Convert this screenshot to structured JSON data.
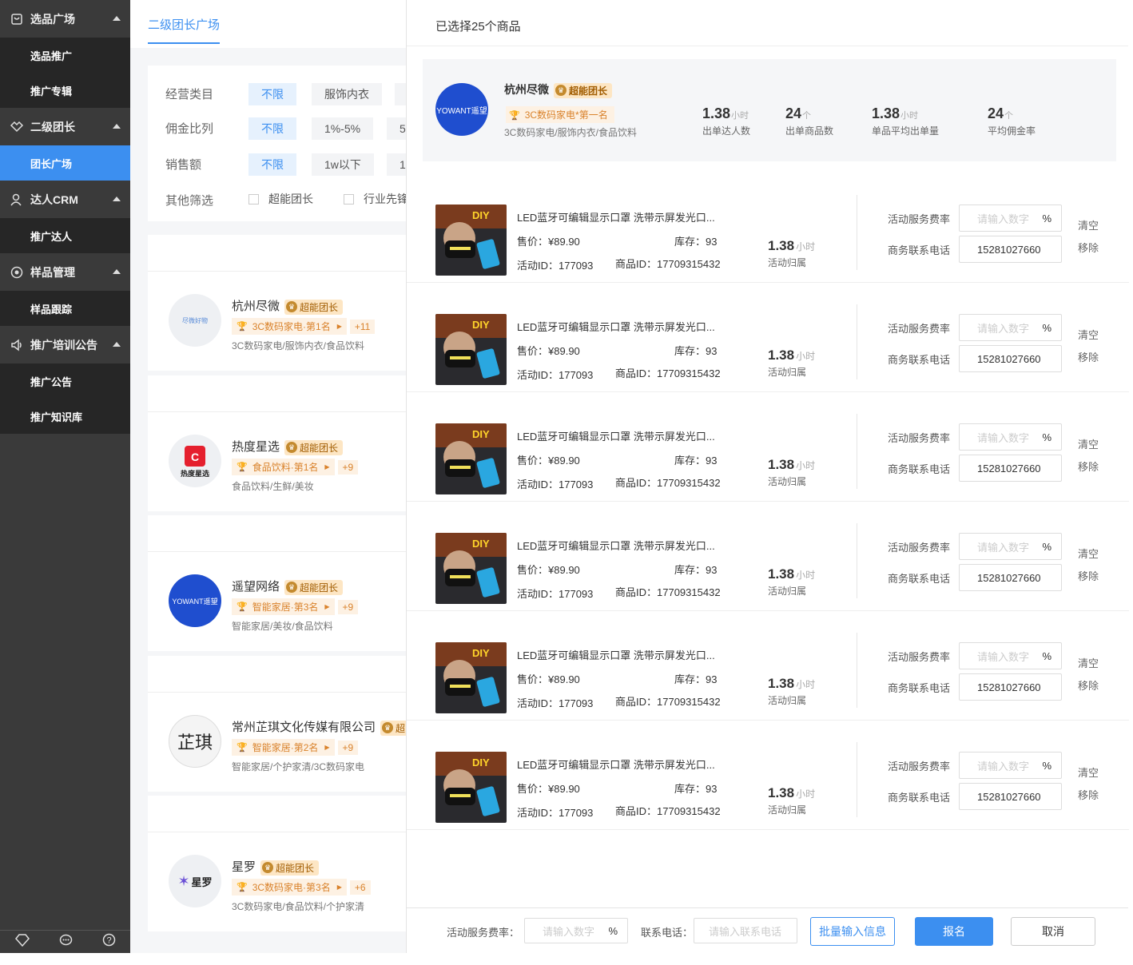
{
  "sidebar": {
    "groups": [
      {
        "label": "选品广场",
        "icon": "bag-icon",
        "subs": [
          "选品推广",
          "推广专辑"
        ]
      },
      {
        "label": "二级团长",
        "icon": "handshake-icon",
        "subs": [
          "团长广场"
        ]
      },
      {
        "label": "达人CRM",
        "icon": "user-icon",
        "subs": [
          "推广达人"
        ]
      },
      {
        "label": "样品管理",
        "icon": "eye-icon",
        "subs": [
          "样品跟踪"
        ]
      },
      {
        "label": "推广培训公告",
        "icon": "speaker-icon",
        "subs": [
          "推广公告",
          "推广知识库"
        ]
      }
    ],
    "active_sub": "团长广场",
    "bottom_icons": [
      "diamond-icon",
      "chat-icon",
      "help-icon"
    ]
  },
  "mid": {
    "tab": "二级团长广场",
    "filters": {
      "rows": [
        {
          "label": "经营类目",
          "options": [
            "不限",
            "服饰内衣"
          ]
        },
        {
          "label": "佣金比列",
          "options": [
            "不限",
            "1%-5%",
            "5"
          ]
        },
        {
          "label": "销售额",
          "options": [
            "不限",
            "1w以下",
            "1"
          ]
        }
      ],
      "other_label": "其他筛选",
      "checks": [
        "超能团长",
        "行业先锋"
      ]
    },
    "teams": [
      {
        "name": "杭州尽微",
        "badge": "超能团长",
        "rank": "3C数码家电·第1名",
        "more": "+11",
        "cats": "3C数码家电/服饰内衣/食品饮料",
        "logo_text": "尽微好物"
      },
      {
        "name": "热度星选",
        "badge": "超能团长",
        "rank": "食品饮料·第1名",
        "more": "+9",
        "cats": "食品饮料/生鲜/美妆",
        "logo_text": "热度星选"
      },
      {
        "name": "遥望网络",
        "badge": "超能团长",
        "rank": "智能家居·第3名",
        "more": "+9",
        "cats": "智能家居/美妆/食品饮料",
        "logo_text": "YOWANT遥望"
      },
      {
        "name": "常州芷琪文化传媒有限公司",
        "badge": "超",
        "rank": "智能家居·第2名",
        "more": "+9",
        "cats": "智能家居/个护家清/3C数码家电",
        "logo_text": "芷琪"
      },
      {
        "name": "星罗",
        "badge": "超能团长",
        "rank": "3C数码家电·第3名",
        "more": "+6",
        "cats": "3C数码家电/食品饮料/个护家清",
        "logo_text": "星罗"
      }
    ]
  },
  "panel": {
    "title": "已选择25个商品",
    "team": {
      "name": "杭州尽微",
      "badge": "超能团长",
      "rank": "3C数码家电*第一名",
      "cats": "3C数码家电/服饰内衣/食品饮料",
      "logo_text": "YOWANT遥望",
      "stats": [
        {
          "value": "1.38",
          "unit": "小时",
          "label": "出单达人数"
        },
        {
          "value": "24",
          "unit": "个",
          "label": "出单商品数"
        },
        {
          "value": "1.38",
          "unit": "小时",
          "label": "单品平均出单量"
        },
        {
          "value": "24",
          "unit": "个",
          "label": "平均佣金率"
        }
      ]
    },
    "product_labels": {
      "price_prefix": "售价：",
      "stock_prefix": "库存：",
      "aid_prefix": "活动ID：",
      "gid_prefix": "商品ID：",
      "hrs_unit": "小时",
      "hrs_label": "活动归属",
      "fee_label": "活动服务费率",
      "fee_placeholder": "请输入数字",
      "pct": "%",
      "phone_label": "商务联系电话",
      "clear": "清空",
      "remove": "移除"
    },
    "products": [
      {
        "title": "LED蓝牙可编辑显示口罩 洗带示屏发光口...",
        "price": "¥89.90",
        "stock": "93",
        "activity_id": "177093",
        "goods_id": "17709315432",
        "hours": "1.38",
        "phone": "15281027660"
      },
      {
        "title": "LED蓝牙可编辑显示口罩 洗带示屏发光口...",
        "price": "¥89.90",
        "stock": "93",
        "activity_id": "177093",
        "goods_id": "17709315432",
        "hours": "1.38",
        "phone": "15281027660"
      },
      {
        "title": "LED蓝牙可编辑显示口罩 洗带示屏发光口...",
        "price": "¥89.90",
        "stock": "93",
        "activity_id": "177093",
        "goods_id": "17709315432",
        "hours": "1.38",
        "phone": "15281027660"
      },
      {
        "title": "LED蓝牙可编辑显示口罩 洗带示屏发光口...",
        "price": "¥89.90",
        "stock": "93",
        "activity_id": "177093",
        "goods_id": "17709315432",
        "hours": "1.38",
        "phone": "15281027660"
      },
      {
        "title": "LED蓝牙可编辑显示口罩 洗带示屏发光口...",
        "price": "¥89.90",
        "stock": "93",
        "activity_id": "177093",
        "goods_id": "17709315432",
        "hours": "1.38",
        "phone": "15281027660"
      },
      {
        "title": "LED蓝牙可编辑显示口罩 洗带示屏发光口...",
        "price": "¥89.90",
        "stock": "93",
        "activity_id": "177093",
        "goods_id": "17709315432",
        "hours": "1.38",
        "phone": "15281027660"
      }
    ],
    "footer": {
      "fee_label": "活动服务费率：",
      "fee_placeholder": "请输入数字",
      "pct": "%",
      "phone_label": "联系电话：",
      "phone_placeholder": "请输入联系电话",
      "batch_button": "批量输入信息",
      "submit_button": "报名",
      "cancel_button": "取消"
    }
  },
  "colors": {
    "accent": "#3c8ff0",
    "sidebar": "#3a3a3a",
    "rank": "#d9822b"
  }
}
